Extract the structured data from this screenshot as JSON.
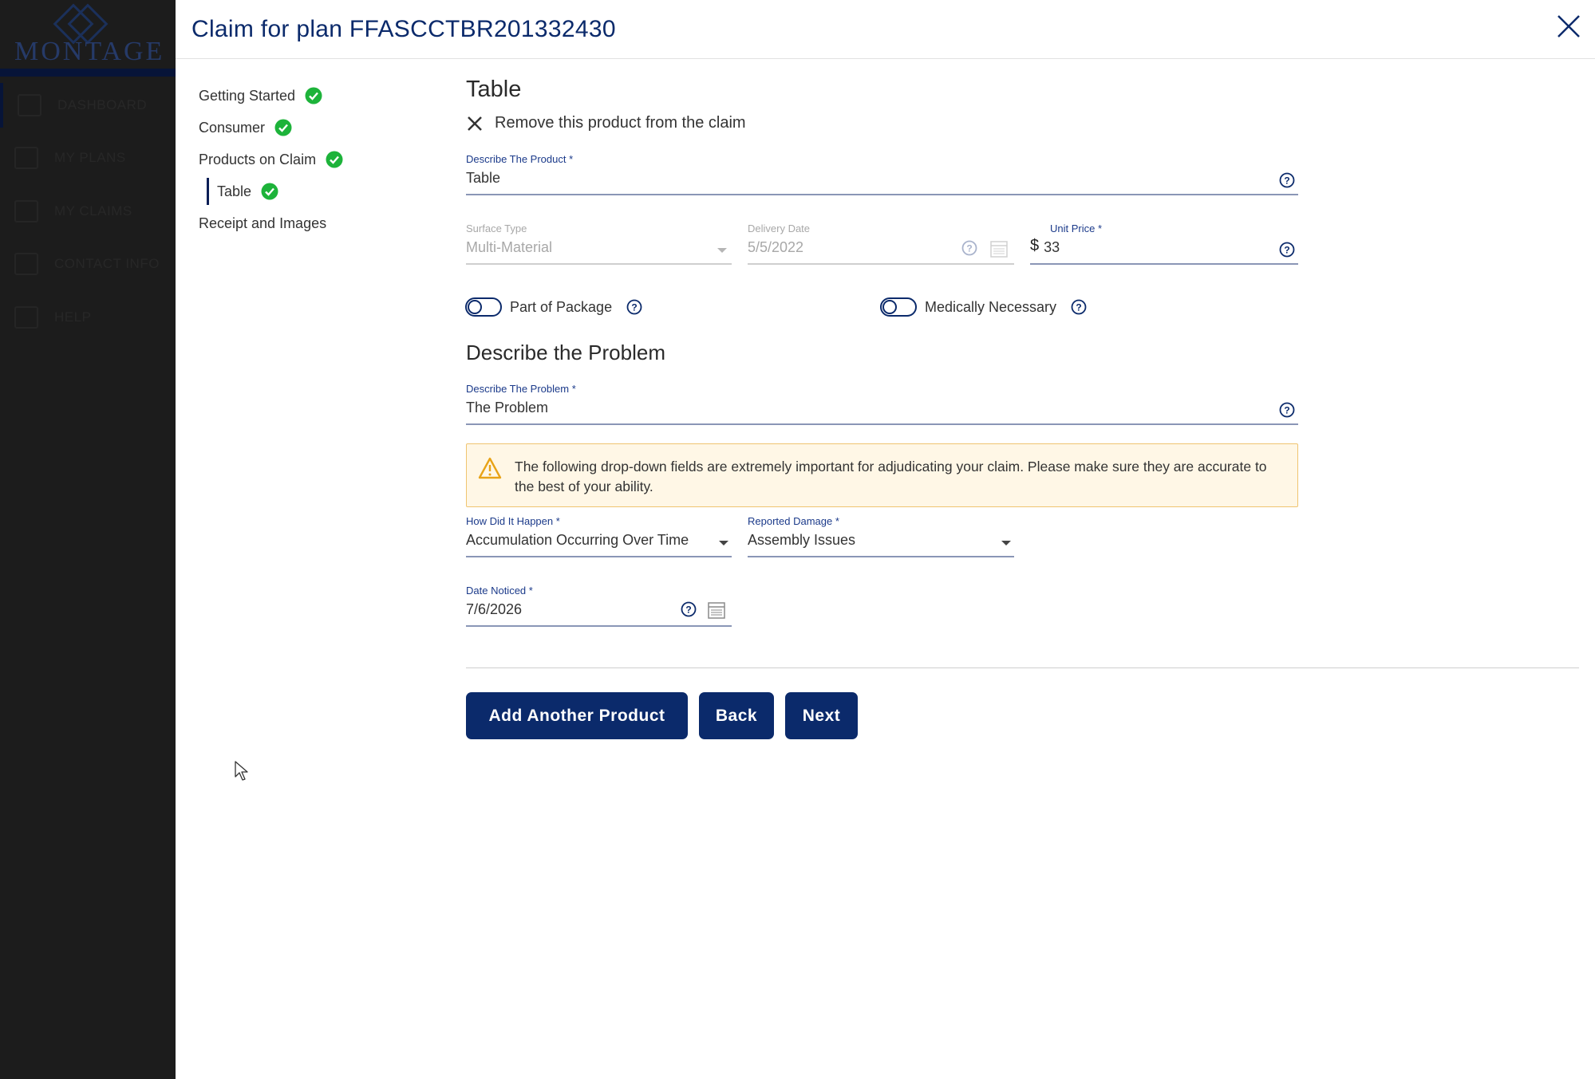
{
  "app": {
    "logo_text": "MONTAGE",
    "nav": [
      {
        "label": "DASHBOARD",
        "icon": "chart-icon",
        "active": true
      },
      {
        "label": "MY PLANS",
        "icon": "document-icon"
      },
      {
        "label": "MY CLAIMS",
        "icon": "claims-icon"
      },
      {
        "label": "CONTACT INFO",
        "icon": "phone-icon"
      },
      {
        "label": "HELP",
        "icon": "chat-icon"
      }
    ]
  },
  "modal": {
    "title": "Claim for plan FFASCCTBR201332430",
    "close_icon": "close-icon"
  },
  "steps": [
    {
      "label": "Getting Started",
      "complete": true
    },
    {
      "label": "Consumer",
      "complete": true
    },
    {
      "label": "Products on Claim",
      "complete": true
    },
    {
      "label": "Table",
      "complete": true,
      "sub": true
    },
    {
      "label": "Receipt and Images",
      "complete": false
    }
  ],
  "product": {
    "section_title": "Table",
    "remove_label": "Remove this product from the claim",
    "describe_label": "Describe The Product *",
    "describe_value": "Table",
    "surface_label": "Surface Type",
    "surface_value": "Multi-Material",
    "delivery_label": "Delivery Date",
    "delivery_value": "5/5/2022",
    "price_label": "Unit Price *",
    "price_currency": "$",
    "price_value": "33",
    "part_of_package_label": "Part of Package",
    "medically_necessary_label": "Medically Necessary"
  },
  "problem": {
    "section_title": "Describe the Problem",
    "describe_label": "Describe The Problem *",
    "describe_value": "The Problem",
    "alert_text": "The following drop-down fields are extremely important for adjudicating your claim. Please make sure they are accurate to the best of your ability.",
    "how_label": "How Did It Happen *",
    "how_value": "Accumulation Occurring Over Time",
    "damage_label": "Reported Damage *",
    "damage_value": "Assembly Issues",
    "date_label": "Date Noticed *",
    "date_value": "7/6/2026"
  },
  "buttons": {
    "add_another": "Add Another Product",
    "back": "Back",
    "next": "Next"
  },
  "colors": {
    "primary": "#0b2a6b",
    "check": "#1db33a",
    "alert_bg": "#fff7e6",
    "alert_border": "#f0c470"
  }
}
